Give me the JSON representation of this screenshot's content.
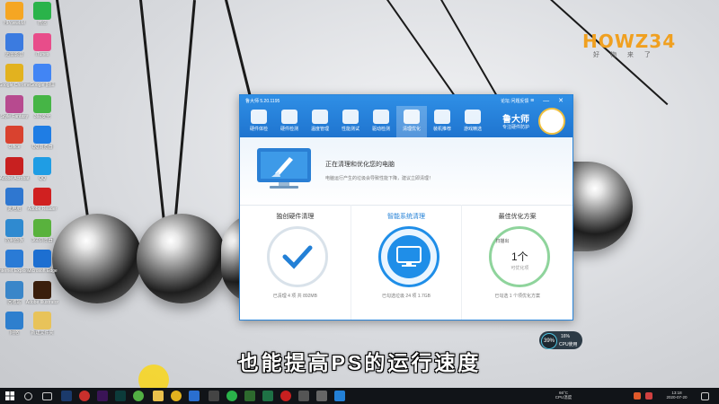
{
  "app": {
    "title": "鲁大师 5.20.1195",
    "top_links": "论坛  问题反馈",
    "window_controls": "≡ — ✕",
    "tabs": [
      {
        "label": "硬件体检",
        "icon": "shield-icon"
      },
      {
        "label": "硬件检测",
        "icon": "chip-icon"
      },
      {
        "label": "温度管理",
        "icon": "thermometer-icon"
      },
      {
        "label": "性能测试",
        "icon": "gauge-icon"
      },
      {
        "label": "驱动检测",
        "icon": "driver-icon"
      },
      {
        "label": "清理优化",
        "icon": "broom-icon"
      },
      {
        "label": "装机推荐",
        "icon": "cube-icon"
      },
      {
        "label": "游戏精选",
        "icon": "gamepad-icon"
      }
    ],
    "active_tab": 5,
    "brand": {
      "name": "鲁大师",
      "slogan": "专注硬件防护"
    },
    "banner": {
      "title": "正在清理和优化您的电脑",
      "desc": "电脑运行产生的垃圾会导致性能下降，建议立即清理！"
    },
    "cards": [
      {
        "title": "独创硬件清理",
        "footer": "已清理 4 项 共 892MB"
      },
      {
        "title": "智能系统清理",
        "footer": "已勾选垃圾 24 项 1.7GB"
      },
      {
        "title": "最佳优化方案",
        "scan_label": "扫描出",
        "count": "1个",
        "count_sub": "可优化项",
        "footer": "已勾选 1 个项优化方案"
      }
    ]
  },
  "desktop_icons": [
    {
      "label": "HPcwwbM",
      "color": "#f5a623"
    },
    {
      "label": "微信",
      "color": "#2ab34a"
    },
    {
      "label": "迅雷影音",
      "color": "#3b7be0"
    },
    {
      "label": "iTunes",
      "color": "#e84d8a"
    },
    {
      "label": "Google Chrome",
      "color": "#e2b21f"
    },
    {
      "label": "Google 翻译",
      "color": "#4285f4"
    },
    {
      "label": "Style Fantasy",
      "color": "#b74a8f"
    },
    {
      "label": "360安全",
      "color": "#46b546"
    },
    {
      "label": "Office",
      "color": "#d9422f"
    },
    {
      "label": "QQ浏览器",
      "color": "#1f7de4"
    },
    {
      "label": "Adobe Acrobat",
      "color": "#c82020"
    },
    {
      "label": "QQ",
      "color": "#1f9de4"
    },
    {
      "label": "此电脑",
      "color": "#2f77d0"
    },
    {
      "label": "Adobe Reader",
      "color": "#d02020"
    },
    {
      "label": "控制面板",
      "color": "#2f8ad0"
    },
    {
      "label": "360浏览器",
      "color": "#59b23d"
    },
    {
      "label": "Internet Explorer",
      "color": "#2a7bd6"
    },
    {
      "label": "Microsoft Edge",
      "color": "#1d6fd1"
    },
    {
      "label": "回收站",
      "color": "#3a86c9"
    },
    {
      "label": "Adobe Illustrator",
      "color": "#3a1e0c"
    },
    {
      "label": "网络",
      "color": "#2e7fce"
    },
    {
      "label": "新建文件夹",
      "color": "#e8c35a"
    }
  ],
  "logo": {
    "text": "HOWZ34",
    "sub": "好 物 来 了"
  },
  "badge": {
    "percent": "39%",
    "line1": "16%",
    "line2": "CPU使用"
  },
  "subtitle": "也能提高PS的运行速度",
  "taskbar": {
    "weather": "66°C",
    "weather_sub": "CPU温度",
    "time": "13:18",
    "date": "2020-07-20"
  }
}
